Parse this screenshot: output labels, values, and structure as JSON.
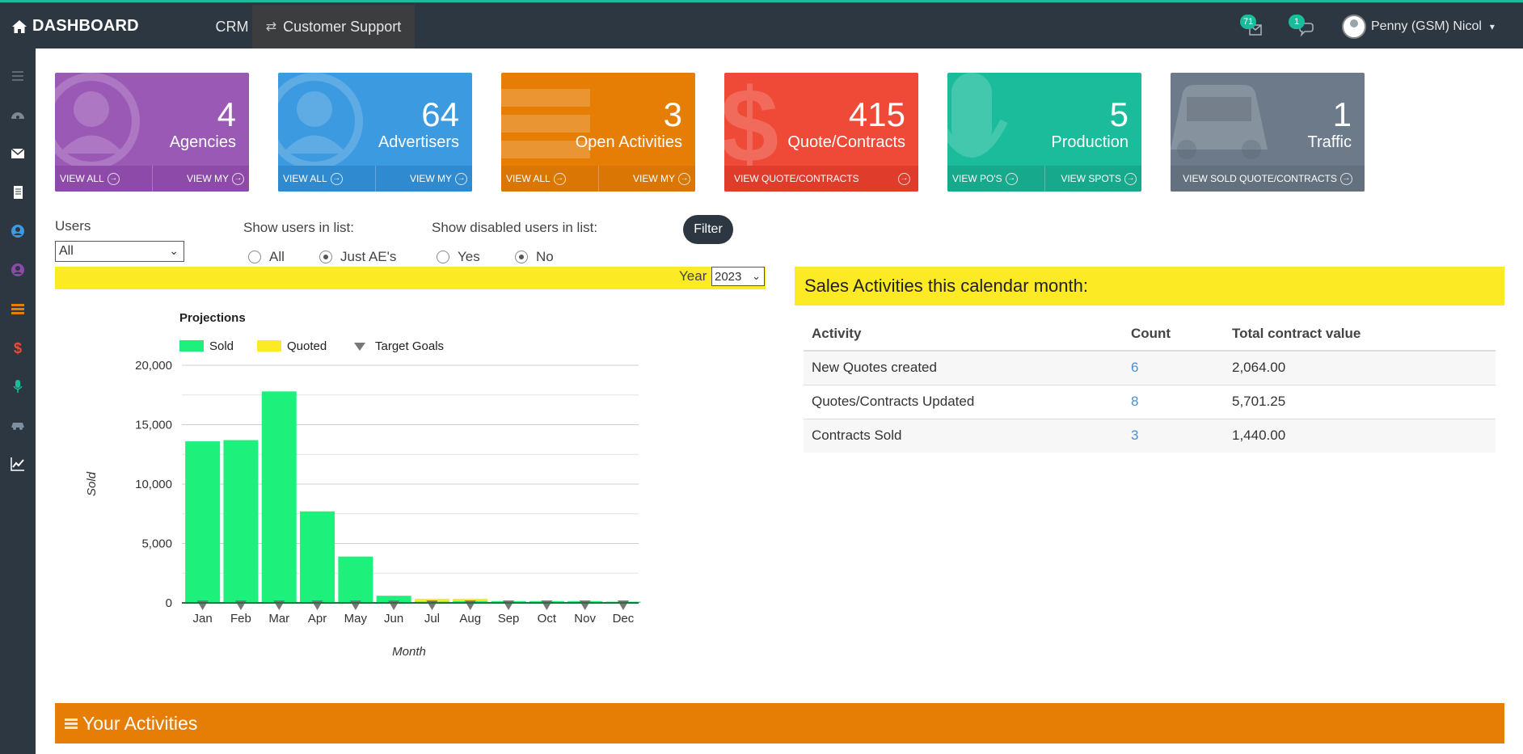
{
  "topbar": {
    "brand": "DASHBOARD",
    "nav": [
      {
        "label": "CRM"
      },
      {
        "label": "Customer Support"
      }
    ],
    "mail_badge": "71",
    "chat_badge": "1",
    "user_name": "Penny (GSM) Nicol"
  },
  "sidebar": {
    "icons": [
      "menu-icon",
      "dashboard-icon",
      "envelope-icon",
      "document-icon",
      "agency-icon",
      "advertiser-icon",
      "activities-icon",
      "dollar-icon",
      "microphone-icon",
      "car-icon",
      "chart-icon"
    ]
  },
  "tiles": [
    {
      "count": "4",
      "label": "Agencies",
      "color": "#9b59b6",
      "foot_color": "#8e4aa8",
      "links": [
        "VIEW ALL",
        "VIEW MY"
      ]
    },
    {
      "count": "64",
      "label": "Advertisers",
      "color": "#3c9ae0",
      "foot_color": "#2f8ad0",
      "links": [
        "VIEW ALL",
        "VIEW MY"
      ]
    },
    {
      "count": "3",
      "label": "Open Activities",
      "color": "#e67e06",
      "foot_color": "#d97604",
      "links": [
        "VIEW ALL",
        "VIEW MY"
      ]
    },
    {
      "count": "415",
      "label": "Quote/Contracts",
      "color": "#ef4a38",
      "foot_color": "#e03c2b",
      "links": [
        "VIEW QUOTE/CONTRACTS"
      ]
    },
    {
      "count": "5",
      "label": "Production",
      "color": "#1bbc9b",
      "foot_color": "#17a98b",
      "links": [
        "VIEW PO'S",
        "VIEW SPOTS"
      ]
    },
    {
      "count": "1",
      "label": "Traffic",
      "color": "#6c7a89",
      "foot_color": "#63707e",
      "links": [
        "VIEW SOLD QUOTE/CONTRACTS"
      ]
    }
  ],
  "filters": {
    "users_label": "Users",
    "users_value": "All",
    "show_users_label": "Show users in list:",
    "show_users_options": [
      "All",
      "Just AE's"
    ],
    "show_users_selected": "Just AE's",
    "show_disabled_label": "Show disabled users in list:",
    "show_disabled_options": [
      "Yes",
      "No"
    ],
    "show_disabled_selected": "No",
    "filter_button": "Filter",
    "year_label": "Year",
    "year_value": "2023"
  },
  "chart_data": {
    "type": "bar",
    "title": "Projections",
    "xlabel": "Month",
    "ylabel": "Sold",
    "ylim": [
      0,
      20000
    ],
    "yticks": [
      0,
      5000,
      10000,
      15000,
      20000
    ],
    "ytick_labels": [
      "0",
      "5,000",
      "10,000",
      "15,000",
      "20,000"
    ],
    "categories": [
      "Jan",
      "Feb",
      "Mar",
      "Apr",
      "May",
      "Jun",
      "Jul",
      "Aug",
      "Sep",
      "Oct",
      "Nov",
      "Dec"
    ],
    "series": [
      {
        "name": "Sold",
        "color": "#1ef07c",
        "values": [
          13600,
          13700,
          17800,
          7700,
          3900,
          600,
          100,
          150,
          150,
          150,
          150,
          100
        ]
      },
      {
        "name": "Quoted",
        "color": "#fcea24",
        "values": [
          0,
          0,
          0,
          0,
          0,
          0,
          350,
          350,
          0,
          0,
          0,
          0
        ]
      },
      {
        "name": "Target Goals",
        "color": "#777777",
        "marker": "triangle-down",
        "values": [
          0,
          0,
          0,
          0,
          0,
          0,
          0,
          0,
          0,
          0,
          0,
          0
        ]
      }
    ],
    "legend": "top-left",
    "grid": true
  },
  "sales": {
    "heading": "Sales Activities this calendar month:",
    "columns": [
      "Activity",
      "Count",
      "Total contract value"
    ],
    "rows": [
      {
        "activity": "New Quotes created",
        "count": "6",
        "value": "2,064.00"
      },
      {
        "activity": "Quotes/Contracts Updated",
        "count": "8",
        "value": "5,701.25"
      },
      {
        "activity": "Contracts Sold",
        "count": "3",
        "value": "1,440.00"
      }
    ]
  },
  "activities": {
    "heading": "Your Activities"
  }
}
